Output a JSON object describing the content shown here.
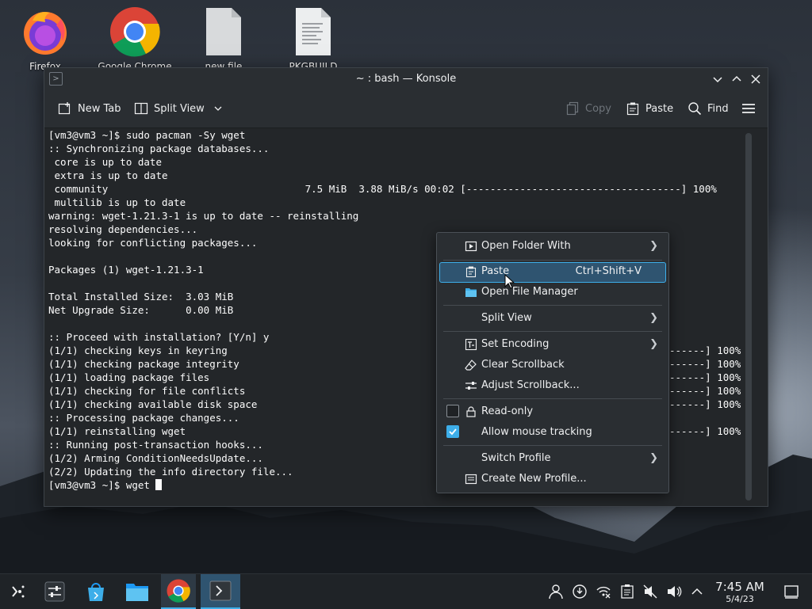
{
  "desktop": {
    "icons": [
      {
        "label": "Firefox",
        "icon": "firefox-icon"
      },
      {
        "label": "Google Chrome",
        "icon": "chrome-icon"
      },
      {
        "label": "new file",
        "icon": "file-icon"
      },
      {
        "label": "PKGBUILD",
        "icon": "text-file-icon"
      }
    ]
  },
  "window": {
    "title": "~ : bash — Konsole",
    "toolbar": {
      "new_tab": "New Tab",
      "split_view": "Split View",
      "copy": "Copy",
      "paste": "Paste",
      "find": "Find"
    }
  },
  "terminal": {
    "lines": [
      "[vm3@vm3 ~]$ sudo pacman -Sy wget",
      ":: Synchronizing package databases...",
      " core is up to date",
      " extra is up to date",
      " community                                 7.5 MiB  3.88 MiB/s 00:02 [------------------------------------] 100%",
      " multilib is up to date",
      "warning: wget-1.21.3-1 is up to date -- reinstalling",
      "resolving dependencies...",
      "looking for conflicting packages...",
      "",
      "Packages (1) wget-1.21.3-1",
      "",
      "Total Installed Size:  3.03 MiB",
      "Net Upgrade Size:      0.00 MiB",
      "",
      ":: Proceed with installation? [Y/n] y",
      "(1/1) checking keys in keyring",
      "(1/1) checking package integrity",
      "(1/1) loading package files",
      "(1/1) checking for file conflicts",
      "(1/1) checking available disk space",
      ":: Processing package changes...",
      "(1/1) reinstalling wget",
      ":: Running post-transaction hooks...",
      "(1/2) Arming ConditionNeedsUpdate...",
      "(2/2) Updating the info directory file...",
      "[vm3@vm3 ~]$ wget "
    ],
    "progress_tails": [
      "------] 100%",
      "------] 100%",
      "------] 100%",
      "------] 100%",
      "------] 100%",
      "------] 100%"
    ]
  },
  "context_menu": {
    "items": [
      {
        "label": "Open Folder With",
        "shortcut": "",
        "submenu": true
      },
      {
        "label": "Paste",
        "shortcut": "Ctrl+Shift+V",
        "submenu": false
      },
      {
        "label": "Open File Manager",
        "shortcut": "",
        "submenu": false
      },
      {
        "label": "Split View",
        "shortcut": "",
        "submenu": true
      },
      {
        "label": "Set Encoding",
        "shortcut": "",
        "submenu": true
      },
      {
        "label": "Clear Scrollback",
        "shortcut": "",
        "submenu": false
      },
      {
        "label": "Adjust Scrollback...",
        "shortcut": "",
        "submenu": false
      },
      {
        "label": "Read-only",
        "shortcut": "",
        "checked": false
      },
      {
        "label": "Allow mouse tracking",
        "shortcut": "",
        "checked": true
      },
      {
        "label": "Switch Profile",
        "shortcut": "",
        "submenu": true
      },
      {
        "label": "Create New Profile...",
        "shortcut": "",
        "submenu": false
      }
    ]
  },
  "taskbar": {
    "clock_time": "7:45 AM",
    "clock_date": "5/4/23",
    "accent": "#3daee9"
  }
}
